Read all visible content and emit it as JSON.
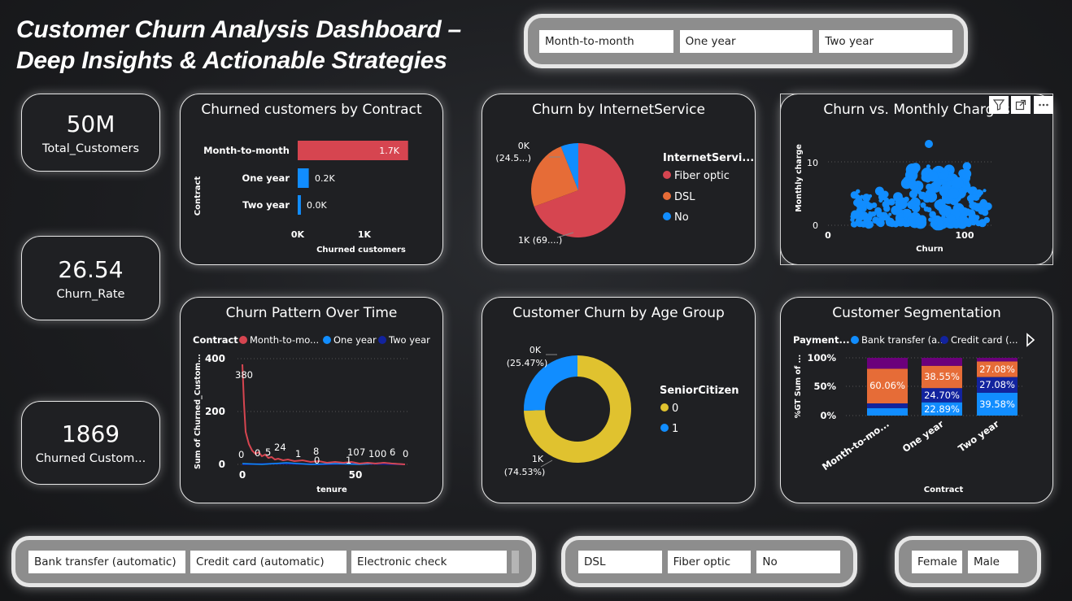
{
  "title": {
    "line1": "Customer Churn Analysis Dashboard –",
    "line2": "Deep Insights & Actionable Strategies"
  },
  "contract_slicer": [
    "Month-to-month",
    "One year",
    "Two year"
  ],
  "kpis": {
    "total_customers": {
      "value": "50M",
      "label": "Total_Customers"
    },
    "churn_rate": {
      "value": "26.54",
      "label": "Churn_Rate"
    },
    "churned_customers": {
      "value": "1869",
      "label": "Churned Custom..."
    }
  },
  "contract_chart": {
    "title": "Churned customers by Contract",
    "y_title": "Contract",
    "x_title": "Churned customers",
    "x_ticks": [
      "0K",
      "1K"
    ],
    "bar_labels": [
      "1.7K",
      "0.2K",
      "0.0K"
    ]
  },
  "internet_chart": {
    "title": "Churn by InternetService",
    "legend_title": "InternetServi...",
    "legend": [
      "Fiber optic",
      "DSL",
      "No"
    ],
    "label_top_1": "0K",
    "label_top_2": "(24.5...)",
    "label_bottom": "1K (69....)"
  },
  "scatter_chart": {
    "title": "Churn vs. Monthly Charges",
    "x_title": "Churn",
    "y_title": "Monthly charge",
    "x_ticks": [
      "0",
      "100"
    ],
    "y_ticks": [
      "10",
      "0"
    ]
  },
  "line_chart": {
    "title": "Churn Pattern Over Time",
    "legend_title": "Contract",
    "legend": [
      "Month-to-mo...",
      "One year",
      "Two year"
    ],
    "y_title": "Sum of Churned_Custom...",
    "x_title": "tenure",
    "y_ticks": [
      "400",
      "200",
      "0"
    ],
    "x_ticks": [
      "0",
      "50"
    ],
    "labels": [
      "380",
      "0",
      "0",
      "5",
      "24",
      "1",
      "8",
      "0",
      "10",
      "7",
      "1",
      "10",
      "0",
      "6",
      "0"
    ]
  },
  "age_chart": {
    "title": "Customer Churn by Age Group",
    "legend_title": "SeniorCitizen",
    "legend": [
      "0",
      "1"
    ],
    "label_top_1": "0K",
    "label_top_2": "(25.47%)",
    "label_bottom_1": "1K",
    "label_bottom_2": "(74.53%)"
  },
  "segment_chart": {
    "title": "Customer Segmentation",
    "legend_title": "Payment...",
    "legend": [
      "Bank transfer (a...",
      "Credit card (..."
    ],
    "y_title": "%GT Sum of ...",
    "x_title": "Contract",
    "y_ticks": [
      "100%",
      "50%",
      "0%"
    ],
    "categories": [
      "Month-to-mo...",
      "One year",
      "Two year"
    ],
    "seg_labels": {
      "m2m_orange": "60.06%",
      "one_orange": "38.55%",
      "one_navy": "24.70%",
      "one_blue": "22.89%",
      "two_orange": "27.08%",
      "two_navy": "27.08%",
      "two_blue": "39.58%"
    }
  },
  "payment_slicer": [
    "Bank transfer (automatic)",
    "Credit card (automatic)",
    "Electronic check"
  ],
  "internet_slicer": [
    "DSL",
    "Fiber optic",
    "No"
  ],
  "gender_slicer": [
    "Female",
    "Male"
  ],
  "colors": {
    "red": "#d64550",
    "blue": "#118dff",
    "orange": "#e66c37",
    "navy": "#12239e",
    "purple": "#6b007b",
    "yellow": "#e0c22f"
  },
  "chart_data": [
    {
      "type": "bar",
      "title": "Churned customers by Contract",
      "categories": [
        "Month-to-month",
        "One year",
        "Two year"
      ],
      "values": [
        1655,
        166,
        48
      ],
      "xlabel": "Churned customers",
      "ylabel": "Contract"
    },
    {
      "type": "pie",
      "title": "Churn by InternetService",
      "categories": [
        "Fiber optic",
        "DSL",
        "No"
      ],
      "values": [
        69.4,
        24.6,
        6.0
      ]
    },
    {
      "type": "pie",
      "title": "Customer Churn by Age Group",
      "categories": [
        "0",
        "1"
      ],
      "values": [
        74.53,
        25.47
      ]
    },
    {
      "type": "bar",
      "title": "Customer Segmentation",
      "categories": [
        "Month-to-mo...",
        "One year",
        "Two year"
      ],
      "series": [
        {
          "name": "Bank transfer (a...",
          "values": [
            13,
            22.89,
            39.58
          ]
        },
        {
          "name": "Credit card (...",
          "values": [
            8,
            24.7,
            27.08
          ]
        },
        {
          "name": "",
          "values": [
            60.06,
            38.55,
            27.08
          ]
        },
        {
          "name": "",
          "values": [
            18.94,
            13.86,
            6.26
          ]
        }
      ],
      "ylim": [
        0,
        100
      ]
    }
  ]
}
